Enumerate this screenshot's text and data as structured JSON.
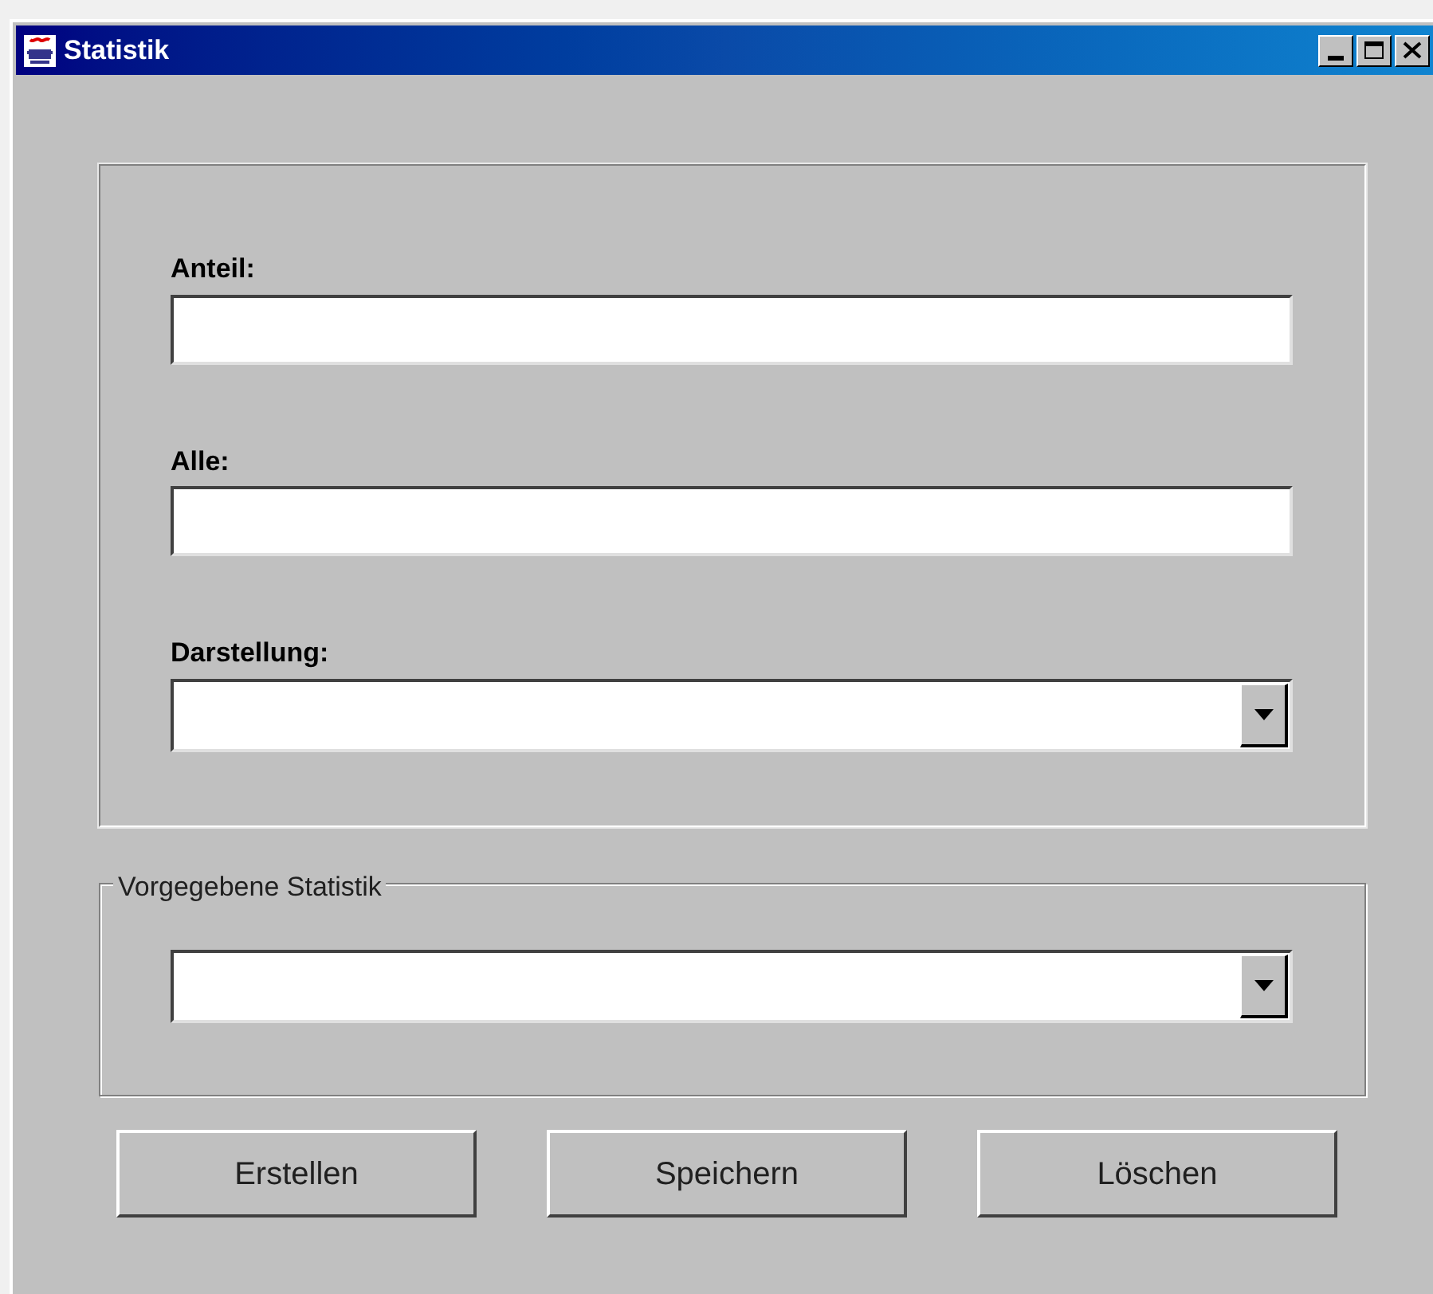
{
  "window": {
    "title": "Statistik"
  },
  "form": {
    "fields": [
      {
        "label": "Anteil:",
        "kind": "text"
      },
      {
        "label": "Alle:",
        "kind": "text"
      },
      {
        "label": "Darstellung:",
        "kind": "combo"
      }
    ]
  },
  "preset_group": {
    "title": "Vorgegebene Statistik",
    "fields": [
      {
        "kind": "combo"
      }
    ]
  },
  "buttons": [
    "Erstellen",
    "Speichern",
    "Löschen"
  ]
}
